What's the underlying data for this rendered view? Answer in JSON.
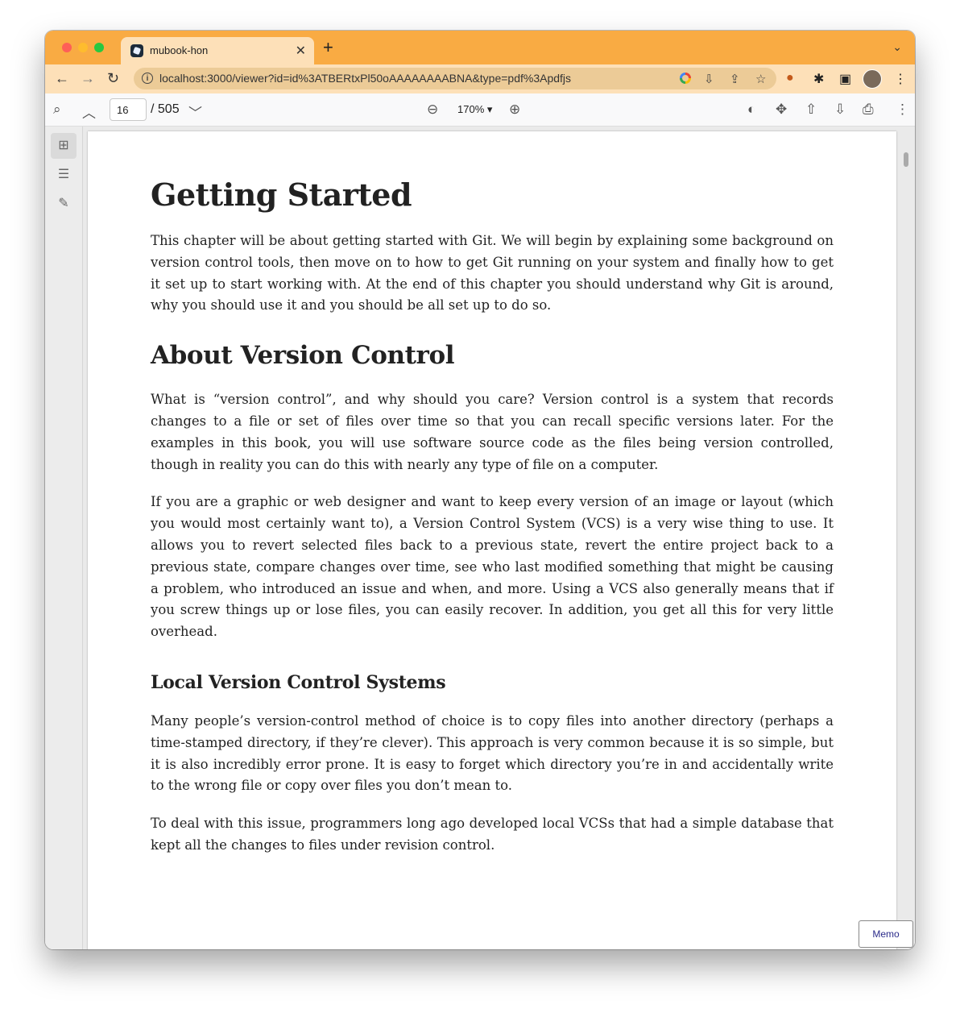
{
  "browser": {
    "tab_title": "mubook-hon",
    "url": "localhost:3000/viewer?id=id%3ATBERtxPl50oAAAAAAAABNA&type=pdf%3Apdfjs"
  },
  "pdf_toolbar": {
    "page_number": "16",
    "page_total": "/ 505",
    "zoom": "170% ▾"
  },
  "document": {
    "h1": "Getting Started",
    "p1": "This chapter will be about getting started with Git. We will begin by explaining some background on version control tools, then move on to how to get Git running on your system and finally how to get it set up to start working with. At the end of this chapter you should understand why Git is around, why you should use it and you should be all set up to do so.",
    "h2": "About Version Control",
    "p2": "What is “version control”, and why should you care? Version control is a system that records changes to a file or set of files over time so that you can recall specific versions later. For the examples in this book, you will use software source code as the files being version controlled, though in reality you can do this with nearly any type of file on a computer.",
    "p3": "If you are a graphic or web designer and want to keep every version of an image or layout (which you would most certainly want to), a Version Control System (VCS) is a very wise thing to use. It allows you to revert selected files back to a previous state, revert the entire project back to a previous state, compare changes over time, see who last modified something that might be causing a problem, who introduced an issue and when, and more. Using a VCS also generally means that if you screw things up or lose files, you can easily recover. In addition, you get all this for very little overhead.",
    "h3": "Local Version Control Systems",
    "p4": "Many people’s version-control method of choice is to copy files into another directory (perhaps a time-stamped directory, if they’re clever). This approach is very common because it is so simple, but it is also incredibly error prone. It is easy to forget which directory you’re in and accidentally write to the wrong file or copy over files you don’t mean to.",
    "p5": "To deal with this issue, programmers long ago developed local VCSs that had a simple database that kept all the changes to files under revision control."
  },
  "memo_label": "Memo"
}
